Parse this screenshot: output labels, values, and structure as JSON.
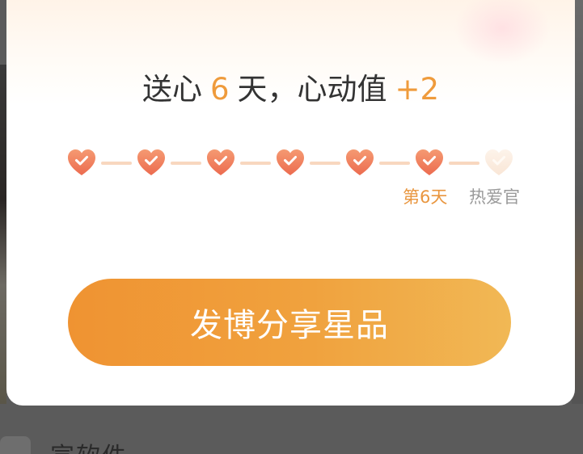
{
  "dialog": {
    "headline": {
      "prefix": "送心",
      "days": "6",
      "middle": "天，心动值",
      "bonus": "+2"
    },
    "progress": {
      "total_days": 7,
      "completed_days": 6,
      "hearts": [
        {
          "status": "done",
          "icon": "heart-check-icon"
        },
        {
          "status": "done",
          "icon": "heart-check-icon"
        },
        {
          "status": "done",
          "icon": "heart-check-icon"
        },
        {
          "status": "done",
          "icon": "heart-check-icon"
        },
        {
          "status": "done",
          "icon": "heart-check-icon"
        },
        {
          "status": "done",
          "icon": "heart-check-icon"
        },
        {
          "status": "pending",
          "icon": "heart-check-icon"
        }
      ],
      "current_label": "第6天",
      "final_label": "热爱官"
    },
    "share_button_label": "发博分享星品"
  },
  "background": {
    "bottom_text": "宣软件"
  },
  "colors": {
    "accent": "#ef9b3c",
    "heart_done": "#f07d5d",
    "heart_pending": "#fbeee2",
    "connector": "#f8d7bf",
    "button_start": "#ef9332",
    "button_end": "#f1b855"
  }
}
